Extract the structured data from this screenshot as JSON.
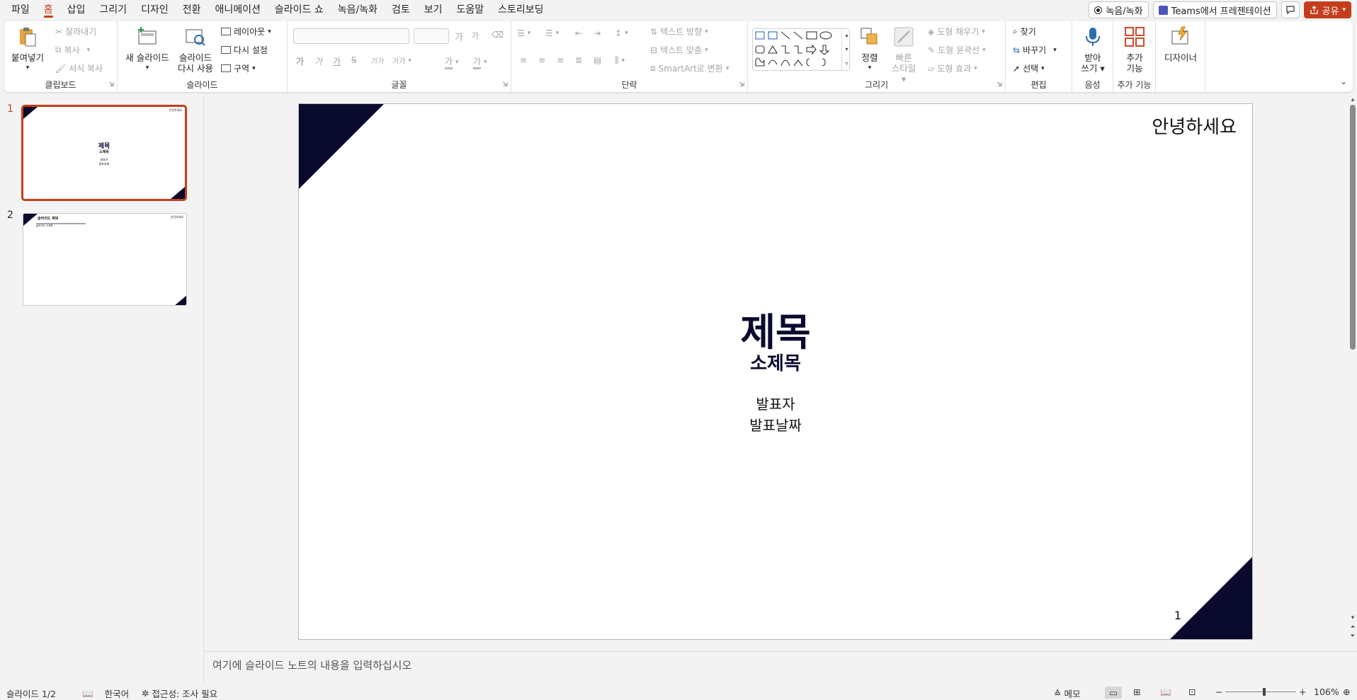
{
  "menu": {
    "tabs": [
      "파일",
      "홈",
      "삽입",
      "그리기",
      "디자인",
      "전환",
      "애니메이션",
      "슬라이드 쇼",
      "녹음/녹화",
      "검토",
      "보기",
      "도움말",
      "스토리보딩"
    ],
    "record_label": "녹음/녹화",
    "teams_label": "Teams에서 프레젠테이션",
    "share_label": "공유"
  },
  "ribbon": {
    "clipboard": {
      "paste": "붙여넣기",
      "cut": "잘라내기",
      "copy": "복사",
      "format_painter": "서식 복사",
      "label": "클립보드"
    },
    "slides": {
      "new_slide": "새 슬라이드",
      "reuse_line1": "슬라이드",
      "reuse_line2": "다시 사용",
      "layout": "레이아웃",
      "reset": "다시 설정",
      "section": "구역",
      "label": "슬라이드"
    },
    "font": {
      "label": "글꼴",
      "grow": "가",
      "shrink": "가",
      "bold": "가",
      "italic": "가",
      "underline": "가",
      "strike": "S",
      "spacing": "가가",
      "case": "가가",
      "highlight": "가",
      "color": "가"
    },
    "paragraph": {
      "text_direction": "텍스트 방향",
      "align_text": "텍스트 맞춤",
      "smartart": "SmartArt로 변환",
      "label": "단락"
    },
    "drawing": {
      "arrange": "정렬",
      "quick_styles_line1": "빠른",
      "quick_styles_line2": "스타일",
      "fill": "도형 채우기",
      "outline": "도형 윤곽선",
      "effects": "도형 효과",
      "label": "그리기"
    },
    "editing": {
      "find": "찾기",
      "replace": "바꾸기",
      "select": "선택",
      "label": "편집"
    },
    "voice": {
      "dictate_line1": "받아",
      "dictate_line2": "쓰기",
      "label": "음성"
    },
    "addins": {
      "addins_line1": "추가",
      "addins_line2": "기능",
      "label": "추가 기능"
    },
    "designer": {
      "designer": "디자이너"
    }
  },
  "thumbnails": [
    {
      "number": "1",
      "title": "제목",
      "subtitle": "소제목",
      "presenter": "발표자",
      "date": "발표날짜",
      "corner_text": "안녕하세요"
    },
    {
      "number": "2",
      "title": "슬라이드 제목",
      "subtitle": "슬라이드 소제목",
      "corner_text": "안녕하세요"
    }
  ],
  "slide": {
    "corner_text": "안녕하세요",
    "title": "제목",
    "subtitle": "소제목",
    "presenter": "발표자",
    "date": "발표날짜",
    "page_number": "1"
  },
  "notes": {
    "placeholder": "여기에 슬라이드 노트의 내용을 입력하십시오"
  },
  "status": {
    "slide_counter": "슬라이드 1/2",
    "language": "한국어",
    "accessibility": "접근성: 조사 필요",
    "notes_button": "메모",
    "zoom": "106%",
    "zoom_fraction": 0.55
  },
  "colors": {
    "accent": "#c43e1c",
    "slide_navy": "#0a0a2e",
    "text_title": "#0a0a2e"
  }
}
